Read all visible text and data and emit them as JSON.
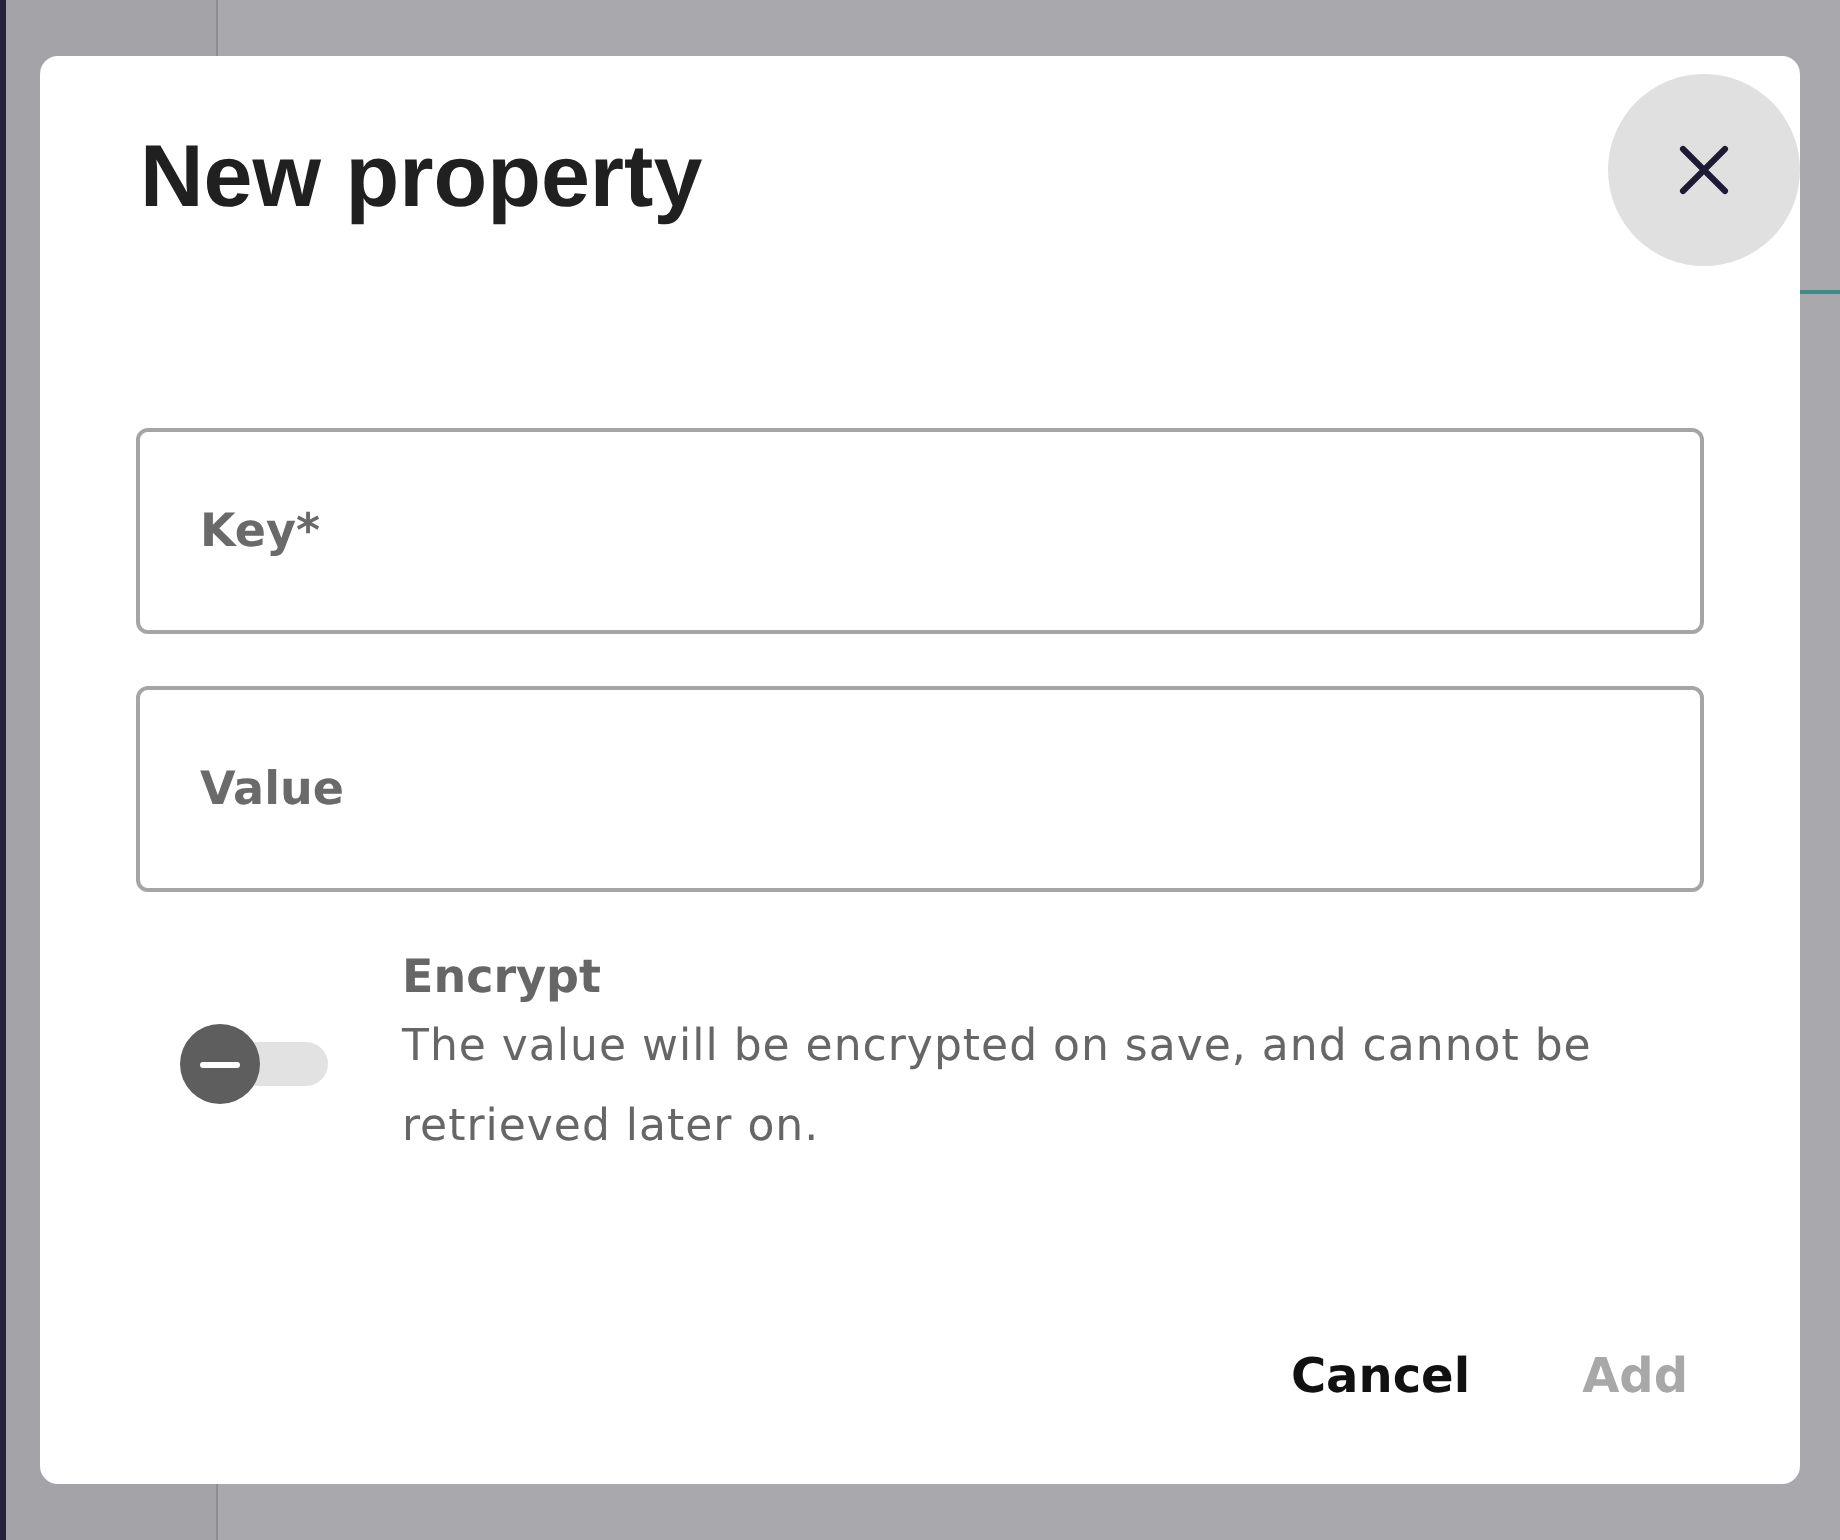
{
  "dialog": {
    "title": "New property",
    "fields": [
      {
        "placeholder": "Key*"
      },
      {
        "placeholder": "Value"
      }
    ],
    "encrypt": {
      "label": "Encrypt",
      "description": "The value will be encrypted on save, and cannot be retrieved later on.",
      "on": false
    },
    "buttons": [
      {
        "label": "Cancel",
        "disabled": false
      },
      {
        "label": "Add",
        "disabled": true
      }
    ]
  }
}
